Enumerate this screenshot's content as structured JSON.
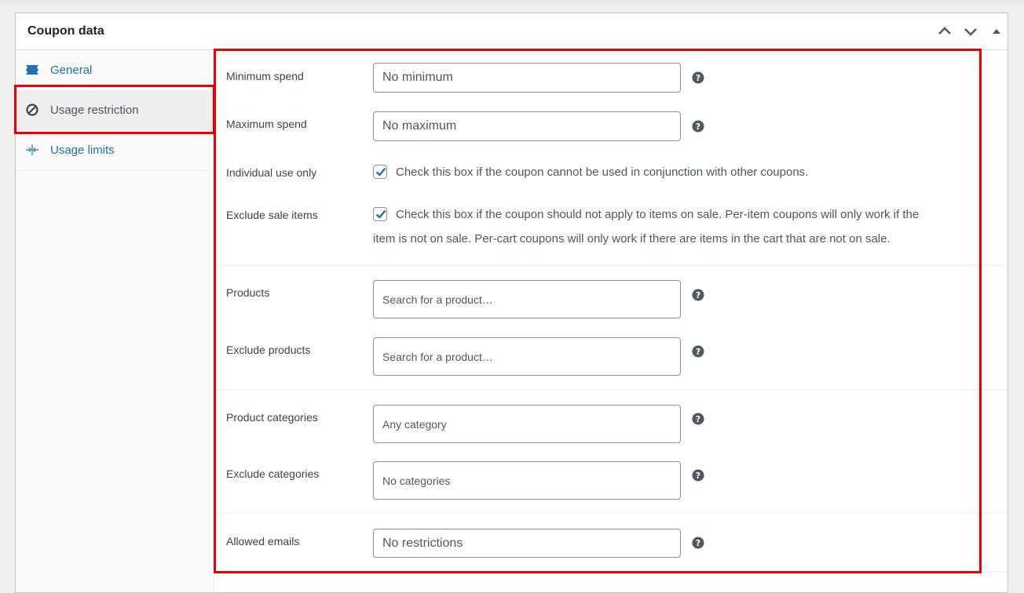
{
  "panel": {
    "title": "Coupon data"
  },
  "tabs": [
    {
      "label": "General",
      "icon": "ticket-icon",
      "active": false
    },
    {
      "label": "Usage restriction",
      "icon": "prohibited-icon",
      "active": true
    },
    {
      "label": "Usage limits",
      "icon": "arrows-in-icon",
      "active": false
    }
  ],
  "fields": {
    "minimum_spend": {
      "label": "Minimum spend",
      "placeholder": "No minimum"
    },
    "maximum_spend": {
      "label": "Maximum spend",
      "placeholder": "No maximum"
    },
    "individual_use": {
      "label": "Individual use only",
      "checked": true,
      "description": "Check this box if the coupon cannot be used in conjunction with other coupons."
    },
    "exclude_sale": {
      "label": "Exclude sale items",
      "checked": true,
      "description_line1": "Check this box if the coupon should not apply to items on sale. Per-item coupons will only work if the",
      "description_line2": "item is not on sale. Per-cart coupons will only work if there are items in the cart that are not on sale."
    },
    "products": {
      "label": "Products",
      "placeholder": "Search for a product…"
    },
    "exclude_products": {
      "label": "Exclude products",
      "placeholder": "Search for a product…"
    },
    "product_categories": {
      "label": "Product categories",
      "placeholder": "Any category"
    },
    "exclude_categories": {
      "label": "Exclude categories",
      "placeholder": "No categories"
    },
    "allowed_emails": {
      "label": "Allowed emails",
      "placeholder": "No restrictions"
    }
  },
  "colors": {
    "link": "#2271b1",
    "highlight": "#ee0000",
    "checkbox": "#2271b1"
  }
}
